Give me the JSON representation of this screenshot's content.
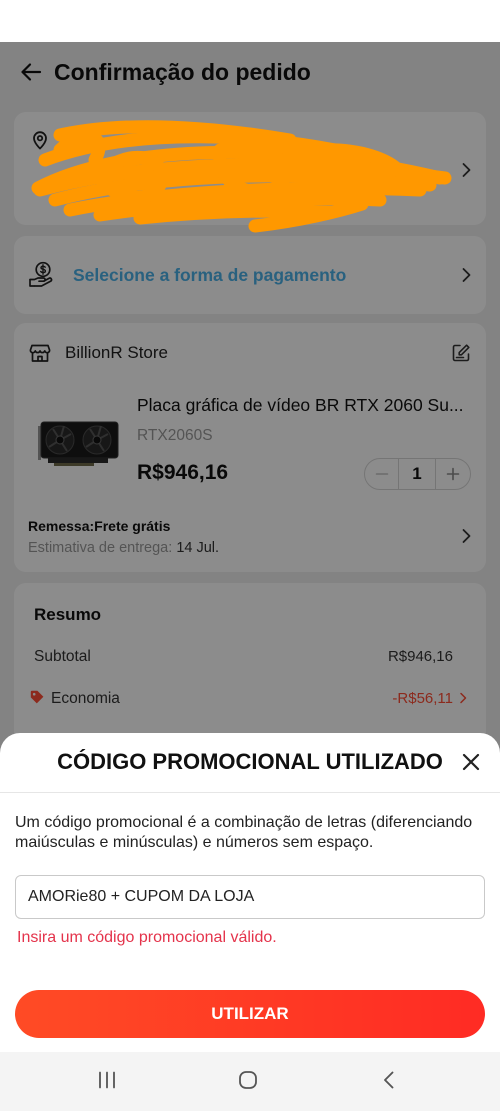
{
  "header": {
    "title": "Confirmação do pedido"
  },
  "payment": {
    "label": "Selecione a forma de pagamento"
  },
  "store": {
    "name": "BillionR Store",
    "product": {
      "title": "Placa gráfica de vídeo BR RTX 2060 Su...",
      "variant": "RTX2060S",
      "price": "R$946,16",
      "quantity": "1"
    },
    "shipping": {
      "label": "Remessa:Frete grátis",
      "eta_label": "Estimativa de entrega:",
      "eta_date": "14 Jul."
    }
  },
  "summary": {
    "title": "Resumo",
    "subtotal": {
      "label": "Subtotal",
      "value": "R$946,16"
    },
    "savings": {
      "label": "Economia",
      "value": "-R$56,11"
    }
  },
  "promo_sheet": {
    "title": "CÓDIGO PROMOCIONAL UTILIZADO",
    "description": "Um código promocional é a combinação de letras (diferenciando maiúsculas e minúsculas) e números sem espaço.",
    "input_value": "AMORie80 + CUPOM DA LOJA",
    "error_message": "Insira um código promocional válido.",
    "submit_label": "UTILIZAR"
  },
  "colors": {
    "button_gradient_start": "#ff4b25",
    "button_gradient_end": "#ff2b24",
    "error_text": "#e4334b",
    "savings_text": "#ff4d36",
    "payment_link_text": "#4cb1e8",
    "redaction_scribble": "#ff9800",
    "overlay": "rgba(0,0,0,0.45)"
  },
  "icons": {
    "back": "arrow-left-icon",
    "address": "location-pin-icon",
    "payment": "hand-coin-icon",
    "store": "store-icon",
    "note": "edit-note-icon",
    "savings": "price-tag-icon",
    "chevron": "chevron-right-icon",
    "close": "close-icon",
    "nav_recents": "recent-apps-icon",
    "nav_home": "home-icon",
    "nav_back": "back-icon"
  }
}
